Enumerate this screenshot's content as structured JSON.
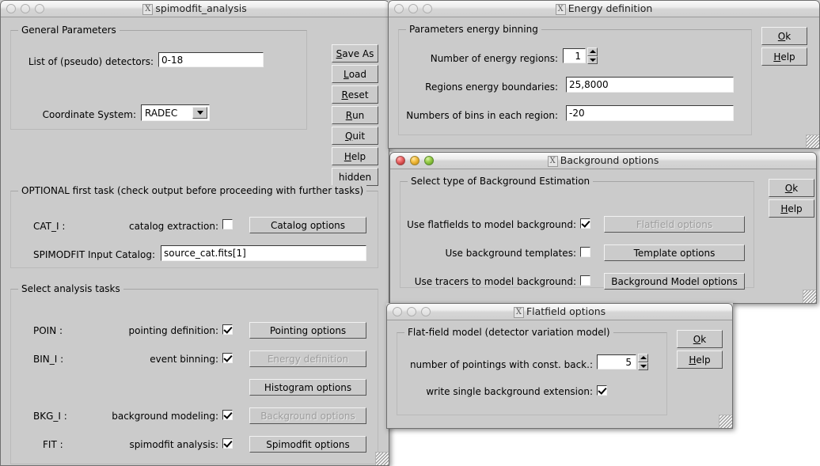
{
  "windows": {
    "main": {
      "title": "spimodfit_analysis",
      "general_group": "General Parameters",
      "detectors_label": "List of (pseudo) detectors:",
      "detectors_value": "0-18",
      "coord_label": "Coordinate System:",
      "coord_value": "RADEC",
      "side_buttons": [
        {
          "mn": "S",
          "rest": "ave As"
        },
        {
          "mn": "L",
          "rest": "oad"
        },
        {
          "mn": "R",
          "rest": "eset"
        },
        {
          "mn": "R",
          "rest": "un"
        },
        {
          "mn": "Q",
          "rest": "uit"
        },
        {
          "mn": "H",
          "rest": "elp"
        }
      ],
      "hidden_button": "hidden",
      "optional_group": "OPTIONAL first task (check output before proceeding with further tasks)",
      "cat_tag": "CAT_I :",
      "cat_extract_label": "catalog extraction:",
      "cat_options_button": "Catalog options",
      "input_catalog_label": "SPIMODFIT Input Catalog:",
      "input_catalog_value": "source_cat.fits[1]",
      "tasks_group": "Select analysis tasks",
      "tasks": [
        {
          "tag": "POIN :",
          "label": "pointing definition:",
          "checked": true,
          "button": "Pointing options",
          "disabled": false
        },
        {
          "tag": "BIN_I :",
          "label": "event binning:",
          "checked": true,
          "button": "Energy definition",
          "disabled": true
        },
        {
          "tag": "",
          "label": "",
          "checked": null,
          "button": "Histogram options",
          "disabled": false
        },
        {
          "tag": "BKG_I :",
          "label": "background modeling:",
          "checked": true,
          "button": "Background options",
          "disabled": true
        },
        {
          "tag": "FIT :",
          "label": "spimodfit analysis:",
          "checked": true,
          "button": "Spimodfit options",
          "disabled": false
        }
      ]
    },
    "energy": {
      "title": "Energy definition",
      "group": "Parameters energy binning",
      "regions_label": "Number of energy regions:",
      "regions_value": "1",
      "boundaries_label": "Regions energy boundaries:",
      "boundaries_value": "25,8000",
      "bins_label": "Numbers of bins in each region:",
      "bins_value": "-20",
      "ok": {
        "mn": "O",
        "rest": "k"
      },
      "help": {
        "mn": "H",
        "rest": "elp"
      }
    },
    "background": {
      "title": "Background options",
      "group": "Select type of Background Estimation",
      "rows": [
        {
          "label": "Use flatfields to model background:",
          "checked": true,
          "button": "Flatfield options",
          "disabled": true
        },
        {
          "label": "Use background templates:",
          "checked": false,
          "button": "Template options",
          "disabled": false
        },
        {
          "label": "Use tracers to model background:",
          "checked": false,
          "button": "Background Model options",
          "disabled": false
        }
      ],
      "ok": {
        "mn": "O",
        "rest": "k"
      },
      "help": {
        "mn": "H",
        "rest": "elp"
      }
    },
    "flatfield": {
      "title": "Flatfield options",
      "group": "Flat-field model (detector variation model)",
      "pointings_label": "number of pointings with const. back.:",
      "pointings_value": "5",
      "write_ext_label": "write single background extension:",
      "write_ext_checked": true,
      "ok": {
        "mn": "O",
        "rest": "k"
      },
      "help": {
        "mn": "H",
        "rest": "elp"
      }
    }
  },
  "colors": {
    "window_bg": "#cbcbcb",
    "desktop_bg": "#ffffff",
    "disabled_text": "#9d9d9d",
    "close_red": "#ef6b6b",
    "min_yellow": "#f5c045",
    "max_green": "#9ed14f"
  }
}
